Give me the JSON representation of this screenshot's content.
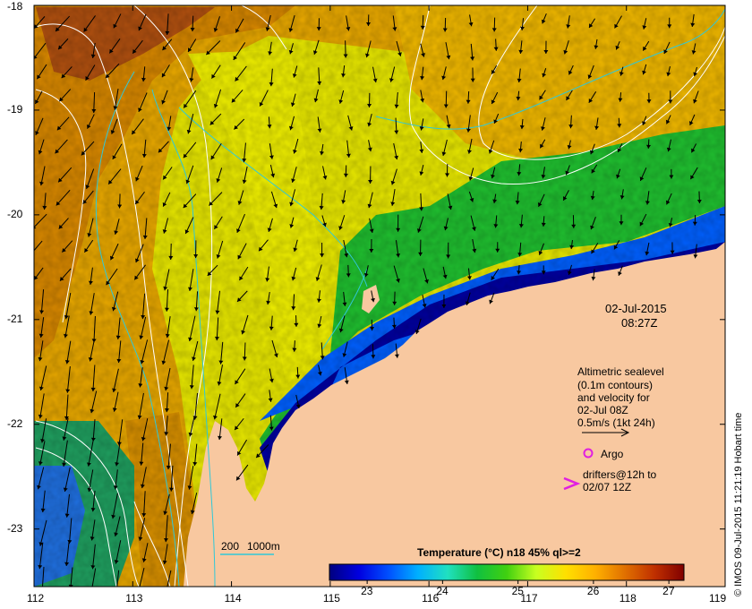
{
  "map": {
    "type": "sea-surface-temperature-map",
    "lon_range": [
      112,
      119
    ],
    "lat_range": [
      -23.55,
      -18
    ],
    "x_tick_labels": [
      "112",
      "113",
      "114",
      "115",
      "116",
      "117",
      "118",
      "119"
    ],
    "y_tick_labels": [
      "-18",
      "-19",
      "-20",
      "-21",
      "-22",
      "-23"
    ],
    "land_color": "#f8c8a0",
    "contour_color": "#ffffff",
    "isobath_color": "#30c8d8",
    "arrow_color": "#000000"
  },
  "labels": {
    "date": "02-Jul-2015",
    "time": "08:27Z",
    "legend_line1": "Altimetric sealevel",
    "legend_line2": "(0.1m contours)",
    "legend_line3": "and velocity for",
    "legend_line4": "02-Jul 08Z",
    "legend_line5": "0.5m/s (1kt 24h)",
    "argo": "Argo",
    "drifters_line1": "drifters@12h to",
    "drifters_line2": "02/07 12Z",
    "depth_200": "200",
    "depth_1000": "1000m",
    "colorbar_title": "Temperature (°C) n18 45% ql>=2",
    "copyright": "© IMOS 09-Jul-2015 11:21:19 Hobart time"
  },
  "colorbar": {
    "min": 22.5,
    "max": 27.2,
    "tick_labels": [
      "23",
      "24",
      "25",
      "26",
      "27"
    ],
    "stops": [
      "#00007f",
      "#0000e0",
      "#0050ff",
      "#00b0ff",
      "#20e0c0",
      "#10c040",
      "#40d010",
      "#c8ff20",
      "#ffe000",
      "#ffb000",
      "#e07000",
      "#c03000",
      "#800000"
    ]
  },
  "markers": {
    "argo_color": "#e020e0",
    "drifter_color": "#e020e0"
  }
}
